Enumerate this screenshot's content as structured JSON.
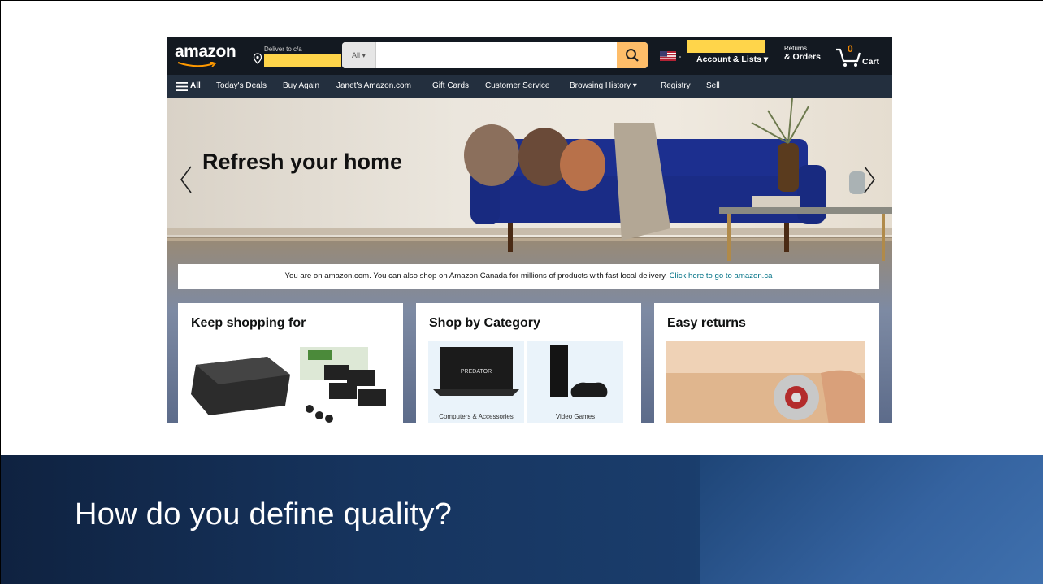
{
  "amazon": {
    "logo_text": "amazon",
    "deliver_label": "Deliver to c/a",
    "search": {
      "department": "All ▾",
      "placeholder": ""
    },
    "account_label": "Account & Lists ▾",
    "returns_line1": "Returns",
    "returns_line2": "& Orders",
    "cart_count": "0",
    "cart_label": "Cart",
    "nav": {
      "all_label": "All",
      "items": [
        "Today's Deals",
        "Buy Again",
        "Janet's Amazon.com",
        "Gift Cards",
        "Customer Service",
        "Browsing History ▾",
        "Registry",
        "Sell"
      ]
    },
    "hero_title": "Refresh your home",
    "banner_text": "You are on amazon.com. You can also shop on Amazon Canada for millions of products with fast local delivery.",
    "banner_link": "Click here to go to amazon.ca",
    "cards": [
      {
        "title": "Keep shopping for"
      },
      {
        "title": "Shop by Category",
        "tiles": [
          "Computers & Accessories",
          "Video Games"
        ],
        "laptop_brand": "PREDATOR"
      },
      {
        "title": "Easy returns"
      }
    ],
    "colors": {
      "nav_dark": "#131921",
      "nav_sub": "#232f3e",
      "search_button": "#febd69",
      "highlight": "#ffd54a",
      "link": "#007185"
    }
  },
  "slide": {
    "title": "How do you define quality?"
  }
}
